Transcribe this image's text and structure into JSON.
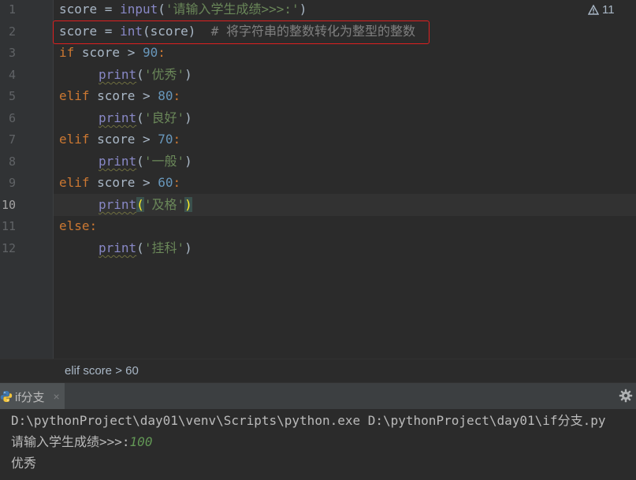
{
  "editor": {
    "line_numbers": [
      "1",
      "2",
      "3",
      "4",
      "5",
      "6",
      "7",
      "8",
      "9",
      "10",
      "11",
      "12"
    ],
    "active_line": "10",
    "warning_count": "11",
    "lines": {
      "l1": {
        "var": "score",
        "op": " = ",
        "fn": "input",
        "open": "(",
        "str": "'请输入学生成绩>>>:'",
        "close": ")"
      },
      "l2": {
        "var": "score",
        "op": " = ",
        "fn": "int",
        "open": "(",
        "arg": "score",
        "close": ")",
        "comment": "  # 将字符串的整数转化为整型的整数"
      },
      "l3": {
        "kw": "if",
        "cond": " score > ",
        "num": "90",
        "colon": ":"
      },
      "l4": {
        "fn": "print",
        "open": "(",
        "str": "'优秀'",
        "close": ")"
      },
      "l5": {
        "kw": "elif",
        "cond": " score > ",
        "num": "80",
        "colon": ":"
      },
      "l6": {
        "fn": "print",
        "open": "(",
        "str": "'良好'",
        "close": ")"
      },
      "l7": {
        "kw": "elif",
        "cond": " score > ",
        "num": "70",
        "colon": ":"
      },
      "l8": {
        "fn": "print",
        "open": "(",
        "str": "'一般'",
        "close": ")"
      },
      "l9": {
        "kw": "elif",
        "cond": " score > ",
        "num": "60",
        "colon": ":"
      },
      "l10": {
        "fn": "print",
        "open": "(",
        "str": "'及格'",
        "close": ")"
      },
      "l11": {
        "kw": "else",
        "colon": ":"
      },
      "l12": {
        "fn": "print",
        "open": "(",
        "str": "'挂科'",
        "close": ")"
      }
    }
  },
  "breadcrumb": "elif score > 60",
  "run_panel": {
    "tab_label": "if分支",
    "tab_close": "×",
    "console": {
      "command": "D:\\pythonProject\\day01\\venv\\Scripts\\python.exe D:\\pythonProject\\day01\\if分支.py",
      "prompt": "请输入学生成绩>>>:",
      "input_value": "100",
      "output": "优秀"
    }
  },
  "colors": {
    "background": "#2b2b2b",
    "keyword": "#cc7832",
    "number": "#6897bb",
    "string": "#6a8759",
    "builtin": "#8888c6",
    "comment": "#808080",
    "highlight_box": "#e02020"
  },
  "icons": [
    "warning-icon",
    "python-icon",
    "close-icon",
    "gear-icon"
  ]
}
